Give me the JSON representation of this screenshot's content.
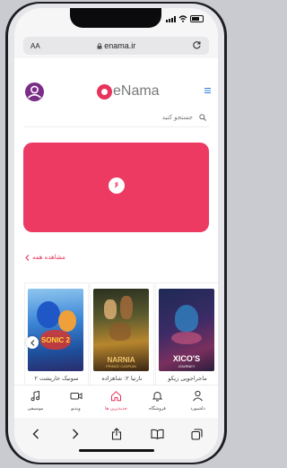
{
  "status": {
    "time": ""
  },
  "browser": {
    "aa": "AA",
    "url": "enama.ir"
  },
  "header": {
    "logo_text": "eNama"
  },
  "search": {
    "placeholder": "جستجو کنید"
  },
  "banner": {
    "badge": "۶"
  },
  "section": {
    "see_all": "مشاهده همه"
  },
  "cards": [
    {
      "title": "ماجراجویی زیکو",
      "poster_caption": "XICO'S",
      "poster_sub": "JOURNEY"
    },
    {
      "title": "نارنیا ۲: شاهزاده",
      "poster_caption": "NARNIA",
      "poster_sub": "PRINCE CASPIAN"
    },
    {
      "title": "سونیک خارپشت ۲",
      "poster_caption": "SONIC 2",
      "poster_sub": ""
    }
  ],
  "bottom_nav": [
    {
      "label": "داشبورد",
      "icon": "user-icon"
    },
    {
      "label": "فروشگاه",
      "icon": "bell-icon"
    },
    {
      "label": "جدیدترین ها",
      "icon": "home-icon"
    },
    {
      "label": "ویدیو",
      "icon": "video-icon"
    },
    {
      "label": "موسیقی",
      "icon": "music-icon"
    }
  ],
  "colors": {
    "brand": "#e8335a",
    "avatar": "#7a2d87",
    "banner": "#ec3a62"
  }
}
